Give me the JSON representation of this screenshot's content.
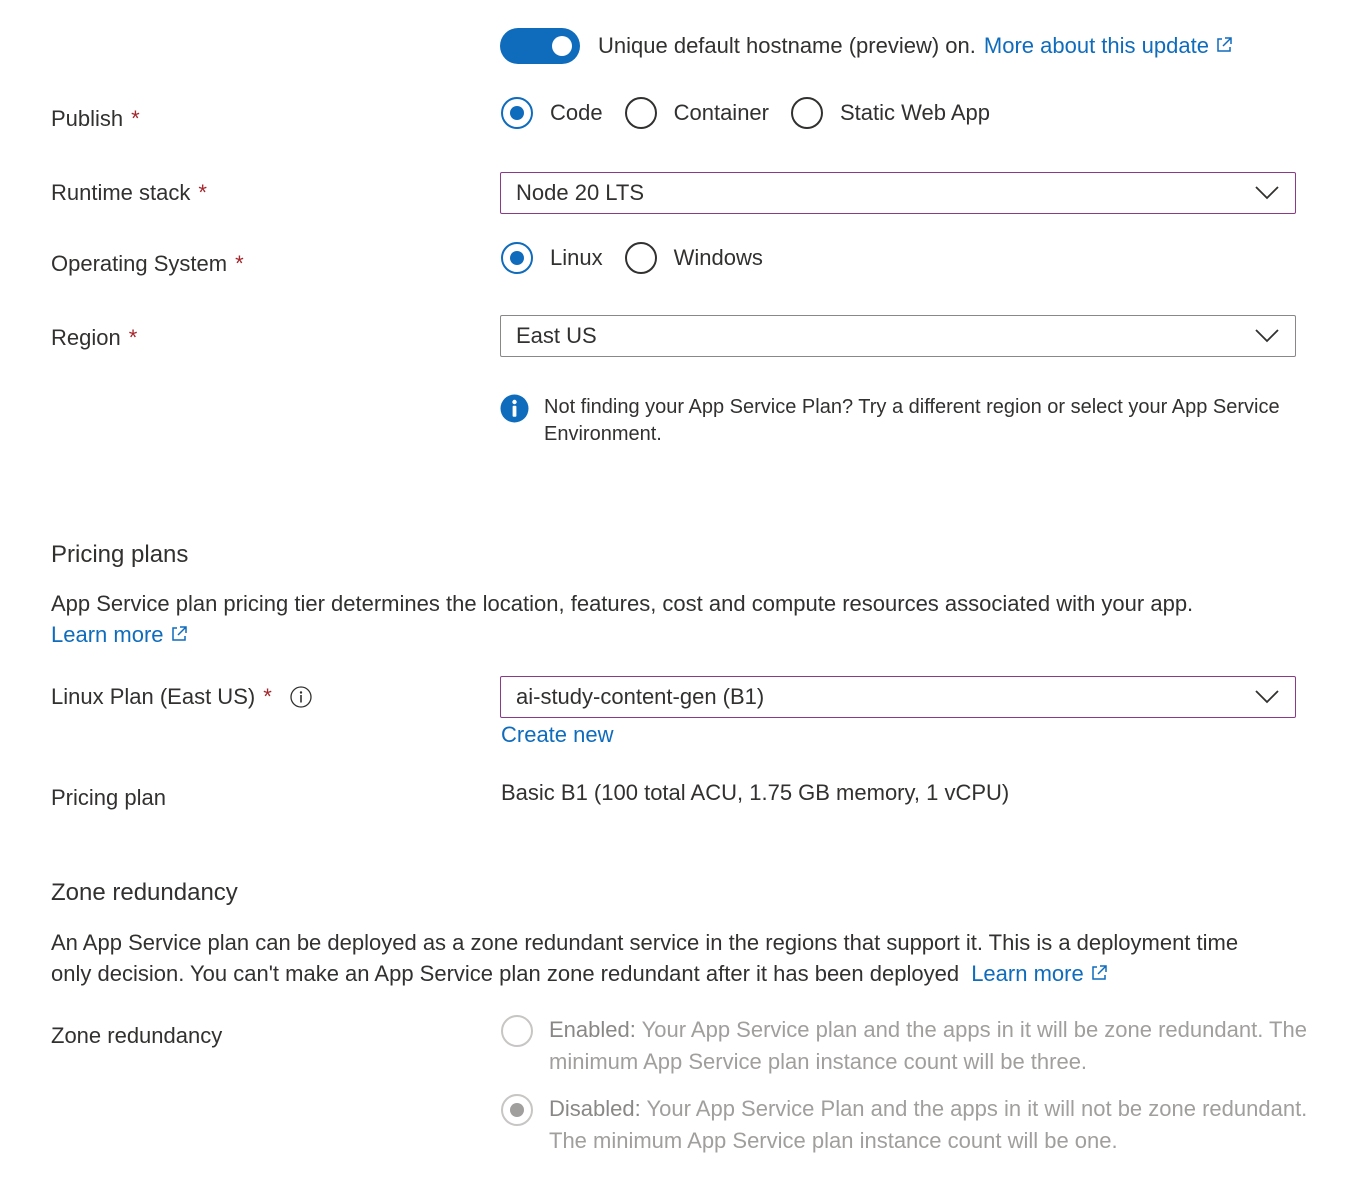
{
  "hostname": {
    "toggle_state": "on",
    "text": "Unique default hostname (preview) on.",
    "link": "More about this update"
  },
  "publish": {
    "label": "Publish",
    "required": "*",
    "options": [
      "Code",
      "Container",
      "Static Web App"
    ],
    "selected": "Code"
  },
  "runtime": {
    "label": "Runtime stack",
    "required": "*",
    "value": "Node 20 LTS"
  },
  "os": {
    "label": "Operating System",
    "required": "*",
    "options": [
      "Linux",
      "Windows"
    ],
    "selected": "Linux"
  },
  "region": {
    "label": "Region",
    "required": "*",
    "value": "East US",
    "info_text": "Not finding your App Service Plan? Try a different region or select your App Service Environment."
  },
  "pricing": {
    "heading": "Pricing plans",
    "description": "App Service plan pricing tier determines the location, features, cost and compute resources associated with your app.",
    "learn_more": "Learn more",
    "linux_plan_label": "Linux Plan (East US)",
    "required": "*",
    "linux_plan_value": "ai-study-content-gen (B1)",
    "create_new": "Create new",
    "pricing_plan_label": "Pricing plan",
    "pricing_plan_value": "Basic B1 (100 total ACU, 1.75 GB memory, 1 vCPU)"
  },
  "zone": {
    "heading": "Zone redundancy",
    "description": "An App Service plan can be deployed as a zone redundant service in the regions that support it. This is a deployment time only decision. You can't make an App Service plan zone redundant after it has been deployed",
    "learn_more": "Learn more",
    "label": "Zone redundancy",
    "enabled_title": "Enabled:",
    "enabled_text": "Your App Service plan and the apps in it will be zone redundant. The minimum App Service plan instance count will be three.",
    "disabled_title": "Disabled:",
    "disabled_text": "Your App Service Plan and the apps in it will not be zone redundant. The minimum App Service plan instance count will be one.",
    "selected": "Disabled"
  },
  "colors": {
    "accent": "#0f6cbd",
    "required": "#a4262c",
    "focus_border": "#8a3a87"
  }
}
